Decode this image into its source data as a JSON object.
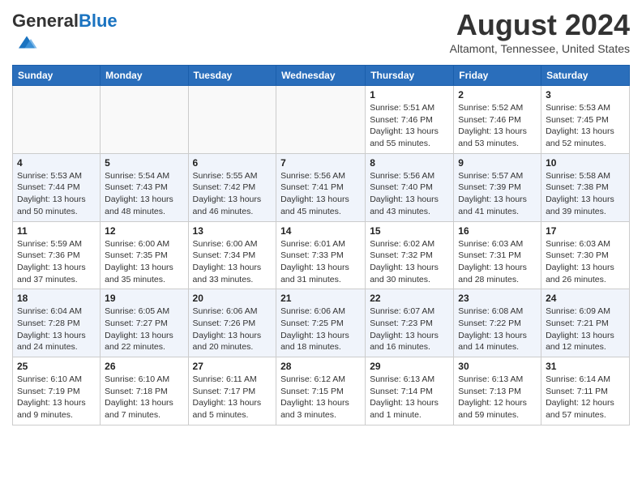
{
  "header": {
    "logo_text_general": "General",
    "logo_text_blue": "Blue",
    "month_year": "August 2024",
    "location": "Altamont, Tennessee, United States"
  },
  "weekdays": [
    "Sunday",
    "Monday",
    "Tuesday",
    "Wednesday",
    "Thursday",
    "Friday",
    "Saturday"
  ],
  "weeks": [
    [
      {
        "day": "",
        "empty": true
      },
      {
        "day": "",
        "empty": true
      },
      {
        "day": "",
        "empty": true
      },
      {
        "day": "",
        "empty": true
      },
      {
        "day": "1",
        "sunrise": "5:51 AM",
        "sunset": "7:46 PM",
        "daylight": "13 hours and 55 minutes."
      },
      {
        "day": "2",
        "sunrise": "5:52 AM",
        "sunset": "7:46 PM",
        "daylight": "13 hours and 53 minutes."
      },
      {
        "day": "3",
        "sunrise": "5:53 AM",
        "sunset": "7:45 PM",
        "daylight": "13 hours and 52 minutes."
      }
    ],
    [
      {
        "day": "4",
        "sunrise": "5:53 AM",
        "sunset": "7:44 PM",
        "daylight": "13 hours and 50 minutes."
      },
      {
        "day": "5",
        "sunrise": "5:54 AM",
        "sunset": "7:43 PM",
        "daylight": "13 hours and 48 minutes."
      },
      {
        "day": "6",
        "sunrise": "5:55 AM",
        "sunset": "7:42 PM",
        "daylight": "13 hours and 46 minutes."
      },
      {
        "day": "7",
        "sunrise": "5:56 AM",
        "sunset": "7:41 PM",
        "daylight": "13 hours and 45 minutes."
      },
      {
        "day": "8",
        "sunrise": "5:56 AM",
        "sunset": "7:40 PM",
        "daylight": "13 hours and 43 minutes."
      },
      {
        "day": "9",
        "sunrise": "5:57 AM",
        "sunset": "7:39 PM",
        "daylight": "13 hours and 41 minutes."
      },
      {
        "day": "10",
        "sunrise": "5:58 AM",
        "sunset": "7:38 PM",
        "daylight": "13 hours and 39 minutes."
      }
    ],
    [
      {
        "day": "11",
        "sunrise": "5:59 AM",
        "sunset": "7:36 PM",
        "daylight": "13 hours and 37 minutes."
      },
      {
        "day": "12",
        "sunrise": "6:00 AM",
        "sunset": "7:35 PM",
        "daylight": "13 hours and 35 minutes."
      },
      {
        "day": "13",
        "sunrise": "6:00 AM",
        "sunset": "7:34 PM",
        "daylight": "13 hours and 33 minutes."
      },
      {
        "day": "14",
        "sunrise": "6:01 AM",
        "sunset": "7:33 PM",
        "daylight": "13 hours and 31 minutes."
      },
      {
        "day": "15",
        "sunrise": "6:02 AM",
        "sunset": "7:32 PM",
        "daylight": "13 hours and 30 minutes."
      },
      {
        "day": "16",
        "sunrise": "6:03 AM",
        "sunset": "7:31 PM",
        "daylight": "13 hours and 28 minutes."
      },
      {
        "day": "17",
        "sunrise": "6:03 AM",
        "sunset": "7:30 PM",
        "daylight": "13 hours and 26 minutes."
      }
    ],
    [
      {
        "day": "18",
        "sunrise": "6:04 AM",
        "sunset": "7:28 PM",
        "daylight": "13 hours and 24 minutes."
      },
      {
        "day": "19",
        "sunrise": "6:05 AM",
        "sunset": "7:27 PM",
        "daylight": "13 hours and 22 minutes."
      },
      {
        "day": "20",
        "sunrise": "6:06 AM",
        "sunset": "7:26 PM",
        "daylight": "13 hours and 20 minutes."
      },
      {
        "day": "21",
        "sunrise": "6:06 AM",
        "sunset": "7:25 PM",
        "daylight": "13 hours and 18 minutes."
      },
      {
        "day": "22",
        "sunrise": "6:07 AM",
        "sunset": "7:23 PM",
        "daylight": "13 hours and 16 minutes."
      },
      {
        "day": "23",
        "sunrise": "6:08 AM",
        "sunset": "7:22 PM",
        "daylight": "13 hours and 14 minutes."
      },
      {
        "day": "24",
        "sunrise": "6:09 AM",
        "sunset": "7:21 PM",
        "daylight": "13 hours and 12 minutes."
      }
    ],
    [
      {
        "day": "25",
        "sunrise": "6:10 AM",
        "sunset": "7:19 PM",
        "daylight": "13 hours and 9 minutes."
      },
      {
        "day": "26",
        "sunrise": "6:10 AM",
        "sunset": "7:18 PM",
        "daylight": "13 hours and 7 minutes."
      },
      {
        "day": "27",
        "sunrise": "6:11 AM",
        "sunset": "7:17 PM",
        "daylight": "13 hours and 5 minutes."
      },
      {
        "day": "28",
        "sunrise": "6:12 AM",
        "sunset": "7:15 PM",
        "daylight": "13 hours and 3 minutes."
      },
      {
        "day": "29",
        "sunrise": "6:13 AM",
        "sunset": "7:14 PM",
        "daylight": "13 hours and 1 minute."
      },
      {
        "day": "30",
        "sunrise": "6:13 AM",
        "sunset": "7:13 PM",
        "daylight": "12 hours and 59 minutes."
      },
      {
        "day": "31",
        "sunrise": "6:14 AM",
        "sunset": "7:11 PM",
        "daylight": "12 hours and 57 minutes."
      }
    ]
  ],
  "labels": {
    "sunrise_prefix": "Sunrise: ",
    "sunset_prefix": "Sunset: ",
    "daylight_prefix": "Daylight: "
  }
}
